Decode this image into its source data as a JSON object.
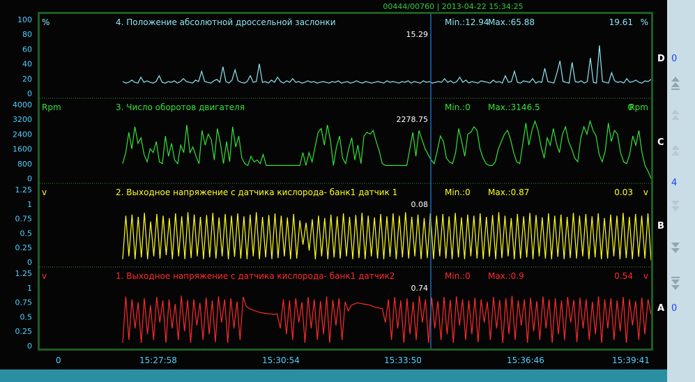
{
  "header": "00444/00760 | 2013-04-22 15:34:25",
  "time_axis": [
    "0",
    "15:27:58",
    "15:30:54",
    "15:33:50",
    "15:36:46",
    "15:39:41"
  ],
  "side_panel": {
    "top_value": "0",
    "mid_value": "4",
    "bottom_value": "0"
  },
  "chart_data": [
    {
      "type": "line",
      "channel": "D",
      "title": "4. Положение абсолютной дроссельной заслонки",
      "unit": "%",
      "min_text": "Min.:12.94",
      "max_text": "Max.:65.88",
      "current_text": "19.61",
      "cursor_value": "15.29",
      "ylim": [
        0,
        100
      ],
      "yticks": [
        "100",
        "80",
        "60",
        "40",
        "20",
        "0"
      ],
      "color": "#8ee6f5",
      "y": [
        16,
        14,
        15,
        18,
        15,
        14,
        22,
        15,
        17,
        15,
        14,
        16,
        24,
        15,
        14,
        16,
        15,
        17,
        14,
        16,
        20,
        16,
        15,
        14,
        18,
        16,
        30,
        16,
        15,
        14,
        17,
        19,
        15,
        36,
        16,
        14,
        18,
        32,
        17,
        15,
        14,
        16,
        24,
        15,
        16,
        40,
        15,
        16,
        14,
        18,
        15,
        22,
        16,
        14,
        17,
        15,
        20,
        15,
        16,
        14,
        15,
        17,
        15,
        16,
        14,
        15,
        16,
        15,
        14,
        16,
        15,
        17,
        14,
        15,
        16,
        14,
        15,
        17,
        15,
        14,
        16,
        15,
        14,
        15,
        16,
        15,
        14,
        17,
        15,
        16,
        15,
        14,
        16,
        15,
        17,
        14,
        16,
        15,
        14,
        17,
        15,
        16,
        14,
        15,
        16,
        15,
        20,
        15,
        17,
        14,
        16,
        22,
        15,
        18,
        14,
        16,
        15,
        14,
        17,
        16,
        15,
        14,
        18,
        15,
        16,
        14,
        24,
        15,
        16,
        30,
        15,
        14,
        17,
        16,
        15,
        20,
        14,
        16,
        15,
        34,
        16,
        15,
        14,
        28,
        44,
        16,
        15,
        14,
        42,
        16,
        15,
        17,
        14,
        16,
        48,
        15,
        14,
        65,
        16,
        15,
        14,
        28,
        17,
        15,
        16,
        14,
        20,
        15,
        16,
        18,
        15,
        14,
        17,
        16,
        19
      ]
    },
    {
      "type": "line",
      "channel": "C",
      "title": "3. Число оборотов двигателя",
      "unit": "Rpm",
      "min_text": "Min.:0",
      "max_text": "Max.:3146.5",
      "current_text": "0",
      "cursor_value": "2278.75",
      "ylim": [
        0,
        4000
      ],
      "yticks": [
        "4000",
        "3200",
        "2400",
        "1600",
        "800",
        "0"
      ],
      "color": "#33e333",
      "y": [
        800,
        1400,
        2500,
        1600,
        2800,
        1900,
        2200,
        1300,
        900,
        1600,
        1400,
        2000,
        900,
        800,
        2300,
        1200,
        1900,
        1000,
        800,
        1800,
        1400,
        2900,
        1400,
        1700,
        1200,
        800,
        2600,
        1800,
        2400,
        2100,
        1000,
        2700,
        1900,
        800,
        2000,
        900,
        2800,
        1700,
        2300,
        1100,
        800,
        700,
        1200,
        900,
        1000,
        800,
        1300,
        700,
        700,
        700,
        700,
        700,
        700,
        700,
        700,
        700,
        700,
        700,
        700,
        1400,
        700,
        1400,
        900,
        1700,
        2500,
        2700,
        1800,
        2900,
        2100,
        700,
        1700,
        2300,
        1100,
        800,
        1600,
        2200,
        1000,
        1800,
        800,
        2300,
        2500,
        2400,
        2600,
        2000,
        1500,
        800,
        700,
        700,
        700,
        700,
        700,
        700,
        700,
        700,
        1600,
        2500,
        1200,
        2600,
        2100,
        1600,
        1300,
        1000,
        800,
        1500,
        2300,
        2000,
        1100,
        900,
        800,
        1400,
        2700,
        2000,
        1200,
        2400,
        2500,
        2800,
        2600,
        1600,
        1100,
        800,
        700,
        700,
        900,
        1600,
        2000,
        2400,
        2600,
        2100,
        1400,
        900,
        800,
        1900,
        3000,
        1800,
        2600,
        3100,
        2600,
        1700,
        1100,
        2200,
        1800,
        2700,
        1900,
        1400,
        2400,
        2800,
        2000,
        1600,
        1100,
        900,
        2200,
        2800,
        2400,
        3100,
        2600,
        2300,
        1300,
        900,
        1500,
        3000,
        2000,
        2600,
        2400,
        1400,
        900,
        800,
        1300,
        2300,
        1800,
        2600,
        1400,
        700,
        400,
        0
      ]
    },
    {
      "type": "line",
      "channel": "B",
      "title": "2. Выходное напряжение с датчика кислорода- банк1 датчик 1",
      "unit": "v",
      "min_text": "Min.:0",
      "max_text": "Max.:0.87",
      "current_text": "0.03",
      "cursor_value": "0.08",
      "ylim": [
        0,
        1.25
      ],
      "yticks": [
        "1.25",
        "1",
        "0.75",
        "0.5",
        "0.25",
        "0"
      ],
      "color": "#ffff1a",
      "y": [
        0.05,
        0.8,
        0.1,
        0.82,
        0.05,
        0.78,
        0.08,
        0.85,
        0.05,
        0.7,
        0.1,
        0.83,
        0.06,
        0.8,
        0.12,
        0.76,
        0.05,
        0.84,
        0.1,
        0.79,
        0.05,
        0.86,
        0.07,
        0.82,
        0.1,
        0.78,
        0.05,
        0.81,
        0.08,
        0.85,
        0.06,
        0.77,
        0.1,
        0.83,
        0.05,
        0.8,
        0.09,
        0.84,
        0.06,
        0.79,
        0.05,
        0.82,
        0.1,
        0.86,
        0.05,
        0.78,
        0.08,
        0.81,
        0.05,
        0.84,
        0.07,
        0.8,
        0.1,
        0.77,
        0.05,
        0.83,
        0.06,
        0.72,
        0.3,
        0.68,
        0.2,
        0.74,
        0.05,
        0.8,
        0.1,
        0.76,
        0.05,
        0.82,
        0.08,
        0.79,
        0.06,
        0.84,
        0.1,
        0.78,
        0.05,
        0.81,
        0.07,
        0.85,
        0.05,
        0.8,
        0.1,
        0.77,
        0.06,
        0.83,
        0.05,
        0.79,
        0.09,
        0.84,
        0.05,
        0.8,
        0.08,
        0.86,
        0.06,
        0.78,
        0.1,
        0.82,
        0.05,
        0.76,
        0.07,
        0.84,
        0.05,
        0.8,
        0.1,
        0.83,
        0.06,
        0.79,
        0.05,
        0.85,
        0.08,
        0.77,
        0.05,
        0.82,
        0.1,
        0.8,
        0.06,
        0.84,
        0.05,
        0.78,
        0.09,
        0.81,
        0.05,
        0.86,
        0.07,
        0.8,
        0.1,
        0.76,
        0.05,
        0.83,
        0.06,
        0.79,
        0.08,
        0.85,
        0.05,
        0.81,
        0.1,
        0.77,
        0.06,
        0.84,
        0.05,
        0.8,
        0.09,
        0.82,
        0.05,
        0.78,
        0.07,
        0.85,
        0.06,
        0.8,
        0.1,
        0.83,
        0.05,
        0.79,
        0.08,
        0.84,
        0.05,
        0.76,
        0.06,
        0.82,
        0.1,
        0.8,
        0.05,
        0.85,
        0.07,
        0.78,
        0.05,
        0.83,
        0.09,
        0.8,
        0.06,
        0.84,
        0.03
      ]
    },
    {
      "type": "line",
      "channel": "A",
      "title": "1. Выходное напряжение с датчика кислорода- банк1 датчик2",
      "unit": "v",
      "min_text": "Min.:0",
      "max_text": "Max.:0.9",
      "current_text": "0.54",
      "cursor_value": "0.74",
      "ylim": [
        0,
        1.25
      ],
      "yticks": [
        "1.25",
        "1",
        "0.75",
        "0.5",
        "0.25",
        "0"
      ],
      "color": "#ff2a2a",
      "y": [
        0.05,
        0.85,
        0.1,
        0.8,
        0.3,
        0.75,
        0.05,
        0.82,
        0.2,
        0.7,
        0.1,
        0.84,
        0.4,
        0.78,
        0.05,
        0.8,
        0.3,
        0.72,
        0.1,
        0.86,
        0.25,
        0.79,
        0.05,
        0.8,
        0.35,
        0.74,
        0.1,
        0.83,
        0.2,
        0.78,
        0.06,
        0.85,
        0.4,
        0.8,
        0.05,
        0.82,
        0.3,
        0.76,
        0.1,
        0.84,
        0.68,
        0.64,
        0.62,
        0.6,
        0.58,
        0.57,
        0.56,
        0.55,
        0.55,
        0.54,
        0.55,
        0.3,
        0.8,
        0.2,
        0.78,
        0.1,
        0.82,
        0.4,
        0.75,
        0.05,
        0.84,
        0.3,
        0.8,
        0.1,
        0.77,
        0.2,
        0.85,
        0.05,
        0.79,
        0.35,
        0.82,
        0.1,
        0.76,
        0.6,
        0.7,
        0.72,
        0.74,
        0.73,
        0.72,
        0.71,
        0.7,
        0.68,
        0.66,
        0.65,
        0.64,
        0.4,
        0.8,
        0.1,
        0.84,
        0.3,
        0.78,
        0.05,
        0.82,
        0.2,
        0.76,
        0.1,
        0.86,
        0.4,
        0.8,
        0.05,
        0.83,
        0.3,
        0.77,
        0.1,
        0.84,
        0.2,
        0.79,
        0.05,
        0.85,
        0.35,
        0.8,
        0.1,
        0.78,
        0.2,
        0.83,
        0.06,
        0.8,
        0.4,
        0.76,
        0.1,
        0.84,
        0.3,
        0.79,
        0.05,
        0.82,
        0.2,
        0.86,
        0.1,
        0.78,
        0.35,
        0.8,
        0.05,
        0.83,
        0.25,
        0.77,
        0.1,
        0.85,
        0.3,
        0.8,
        0.05,
        0.82,
        0.2,
        0.78,
        0.1,
        0.84,
        0.4,
        0.79,
        0.06,
        0.83,
        0.3,
        0.8,
        0.1,
        0.76,
        0.2,
        0.85,
        0.05,
        0.8,
        0.3,
        0.82,
        0.1,
        0.78,
        0.25,
        0.84,
        0.05,
        0.8,
        0.35,
        0.77,
        0.1,
        0.83,
        0.2,
        0.8,
        0.54
      ]
    }
  ]
}
